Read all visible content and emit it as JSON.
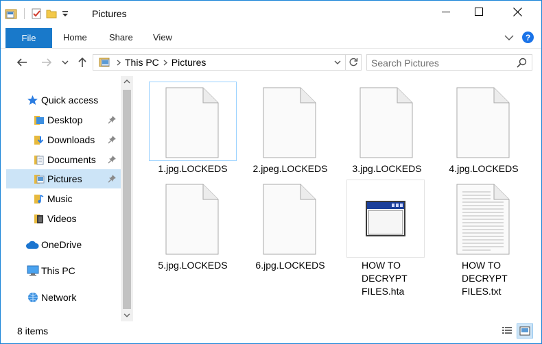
{
  "window": {
    "title": "Pictures"
  },
  "ribbon": {
    "tabs": [
      {
        "label": "File"
      },
      {
        "label": "Home"
      },
      {
        "label": "Share"
      },
      {
        "label": "View"
      }
    ],
    "help_label": "?"
  },
  "navigation": {
    "breadcrumb": [
      "This PC",
      "Pictures"
    ],
    "search_placeholder": "Search Pictures"
  },
  "sidebar": {
    "items": [
      {
        "label": "Quick access",
        "icon": "star-icon"
      },
      {
        "label": "Desktop",
        "icon": "folder-icon",
        "pinned": true
      },
      {
        "label": "Downloads",
        "icon": "downloads-folder-icon",
        "pinned": true
      },
      {
        "label": "Documents",
        "icon": "documents-folder-icon",
        "pinned": true
      },
      {
        "label": "Pictures",
        "icon": "pictures-folder-icon",
        "pinned": true,
        "selected": true
      },
      {
        "label": "Music",
        "icon": "music-folder-icon"
      },
      {
        "label": "Videos",
        "icon": "videos-folder-icon"
      },
      {
        "label": "OneDrive",
        "icon": "cloud-icon"
      },
      {
        "label": "This PC",
        "icon": "computer-icon"
      },
      {
        "label": "Network",
        "icon": "network-icon"
      }
    ]
  },
  "files": [
    {
      "name": "1.jpg.LOCKEDS",
      "type": "blank-file-icon",
      "selected": true
    },
    {
      "name": "2.jpeg.LOCKEDS",
      "type": "blank-file-icon"
    },
    {
      "name": "3.jpg.LOCKEDS",
      "type": "blank-file-icon"
    },
    {
      "name": "4.jpg.LOCKEDS",
      "type": "blank-file-icon"
    },
    {
      "name": "5.jpg.LOCKEDS",
      "type": "blank-file-icon"
    },
    {
      "name": "6.jpg.LOCKEDS",
      "type": "blank-file-icon"
    },
    {
      "name_lines": [
        "HOW TO",
        "DECRYPT",
        "FILES.hta"
      ],
      "type": "hta-application-icon"
    },
    {
      "name_lines": [
        "HOW TO",
        "DECRYPT",
        "FILES.txt"
      ],
      "type": "text-document-icon"
    }
  ],
  "status": {
    "item_count": "8 items"
  },
  "colors": {
    "accent": "#1979ca",
    "selection": "#cce4f7",
    "selection_border": "#99d1ff"
  }
}
